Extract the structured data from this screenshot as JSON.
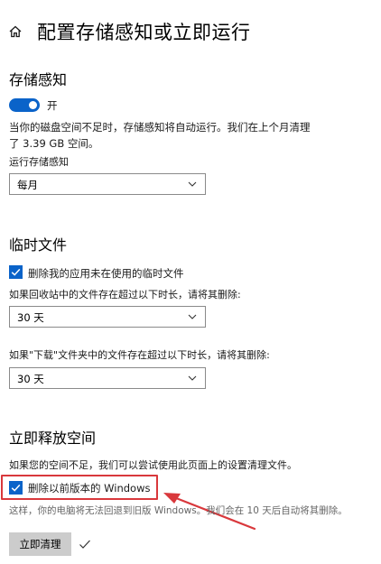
{
  "header": {
    "title": "配置存储感知或立即运行"
  },
  "storage_sense": {
    "title": "存储感知",
    "toggle_state": "开",
    "description_line1": "当你的磁盘空间不足时，存储感知将自动运行。我们在上个月清理",
    "description_line2": "了 3.39 GB 空间。",
    "run_label": "运行存储感知",
    "run_value": "每月"
  },
  "temp_files": {
    "title": "临时文件",
    "delete_unused_label": "删除我的应用未在使用的临时文件",
    "delete_unused_checked": true,
    "recycle_label": "如果回收站中的文件存在超过以下时长，请将其删除:",
    "recycle_value": "30 天",
    "downloads_label": "如果\"下载\"文件夹中的文件存在超过以下时长，请将其删除:",
    "downloads_value": "30 天"
  },
  "free_up": {
    "title": "立即释放空间",
    "description": "如果您的空间不足，我们可以尝试使用此页面上的设置清理文件。",
    "delete_windows_label": "删除以前版本的 Windows",
    "delete_windows_checked": true,
    "note": "这样，你的电脑将无法回退到旧版 Windows。我们会在 10 天后自动将其删除。",
    "clean_button": "立即清理"
  },
  "colors": {
    "accent": "#0a63c9",
    "highlight": "#d9383c",
    "button_bg": "#cccccc"
  }
}
